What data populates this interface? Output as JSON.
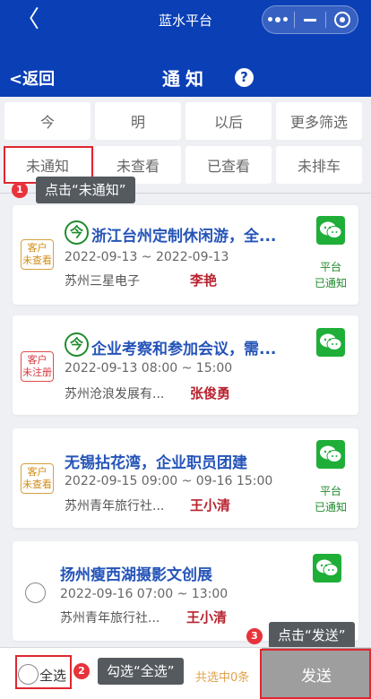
{
  "header": {
    "back_arrow": "〈",
    "app_title": "蓝水平台",
    "return_label": "<返回",
    "page_title": "通知",
    "help_icon": "?"
  },
  "filters": {
    "row1": [
      "今",
      "明",
      "以后",
      "更多筛选"
    ],
    "row2": [
      "未通知",
      "未查看",
      "已查看",
      "未排车"
    ]
  },
  "guides": {
    "step1": {
      "num": "1",
      "text": "点击“未通知”"
    },
    "step2": {
      "num": "2",
      "text": "勾选“全选”"
    },
    "step3": {
      "num": "3",
      "text": "点击“发送”"
    }
  },
  "cards": [
    {
      "status": "客户\n未查看",
      "today_badge": "今",
      "title": "浙江台州定制休闲游，全...",
      "time": "2022-09-13 ~ 2022-09-13",
      "company": "苏州三星电子",
      "contact": "李艳",
      "notify_status": "平台\n已通知"
    },
    {
      "status": "客户\n未注册",
      "today_badge": "今",
      "title": "企业考察和参加会议，需...",
      "time": "2022-09-13 08:00 ~ 15:00",
      "company": "苏州沧浪发展有...",
      "contact": "张俊勇",
      "notify_status": ""
    },
    {
      "status": "客户\n未查看",
      "today_badge": "",
      "title": "无锡拈花湾，企业职员团建",
      "time": "2022-09-15 09:00 ~ 09-16 15:00",
      "company": "苏州青年旅行社...",
      "contact": "王小清",
      "notify_status": "平台\n已通知"
    },
    {
      "status": "",
      "today_badge": "",
      "title": "扬州瘦西湖摄影文创展",
      "time": "2022-09-16 07:00 ~ 13:00",
      "company": "苏州青年旅行社...",
      "contact": "王小清",
      "notify_status": ""
    }
  ],
  "bottom": {
    "select_all": "全选",
    "selected_count": "共选中0条",
    "send": "发送"
  },
  "colors": {
    "header_bg": "#0a3fb6",
    "title_blue": "#2554b8",
    "contact_red": "#b8232f",
    "wechat_green": "#1fae38",
    "highlight_red": "#e0262f",
    "send_bg": "#9e9e9e"
  },
  "icons": {
    "wechat": "wechat-icon",
    "today": "today-badge-icon"
  }
}
